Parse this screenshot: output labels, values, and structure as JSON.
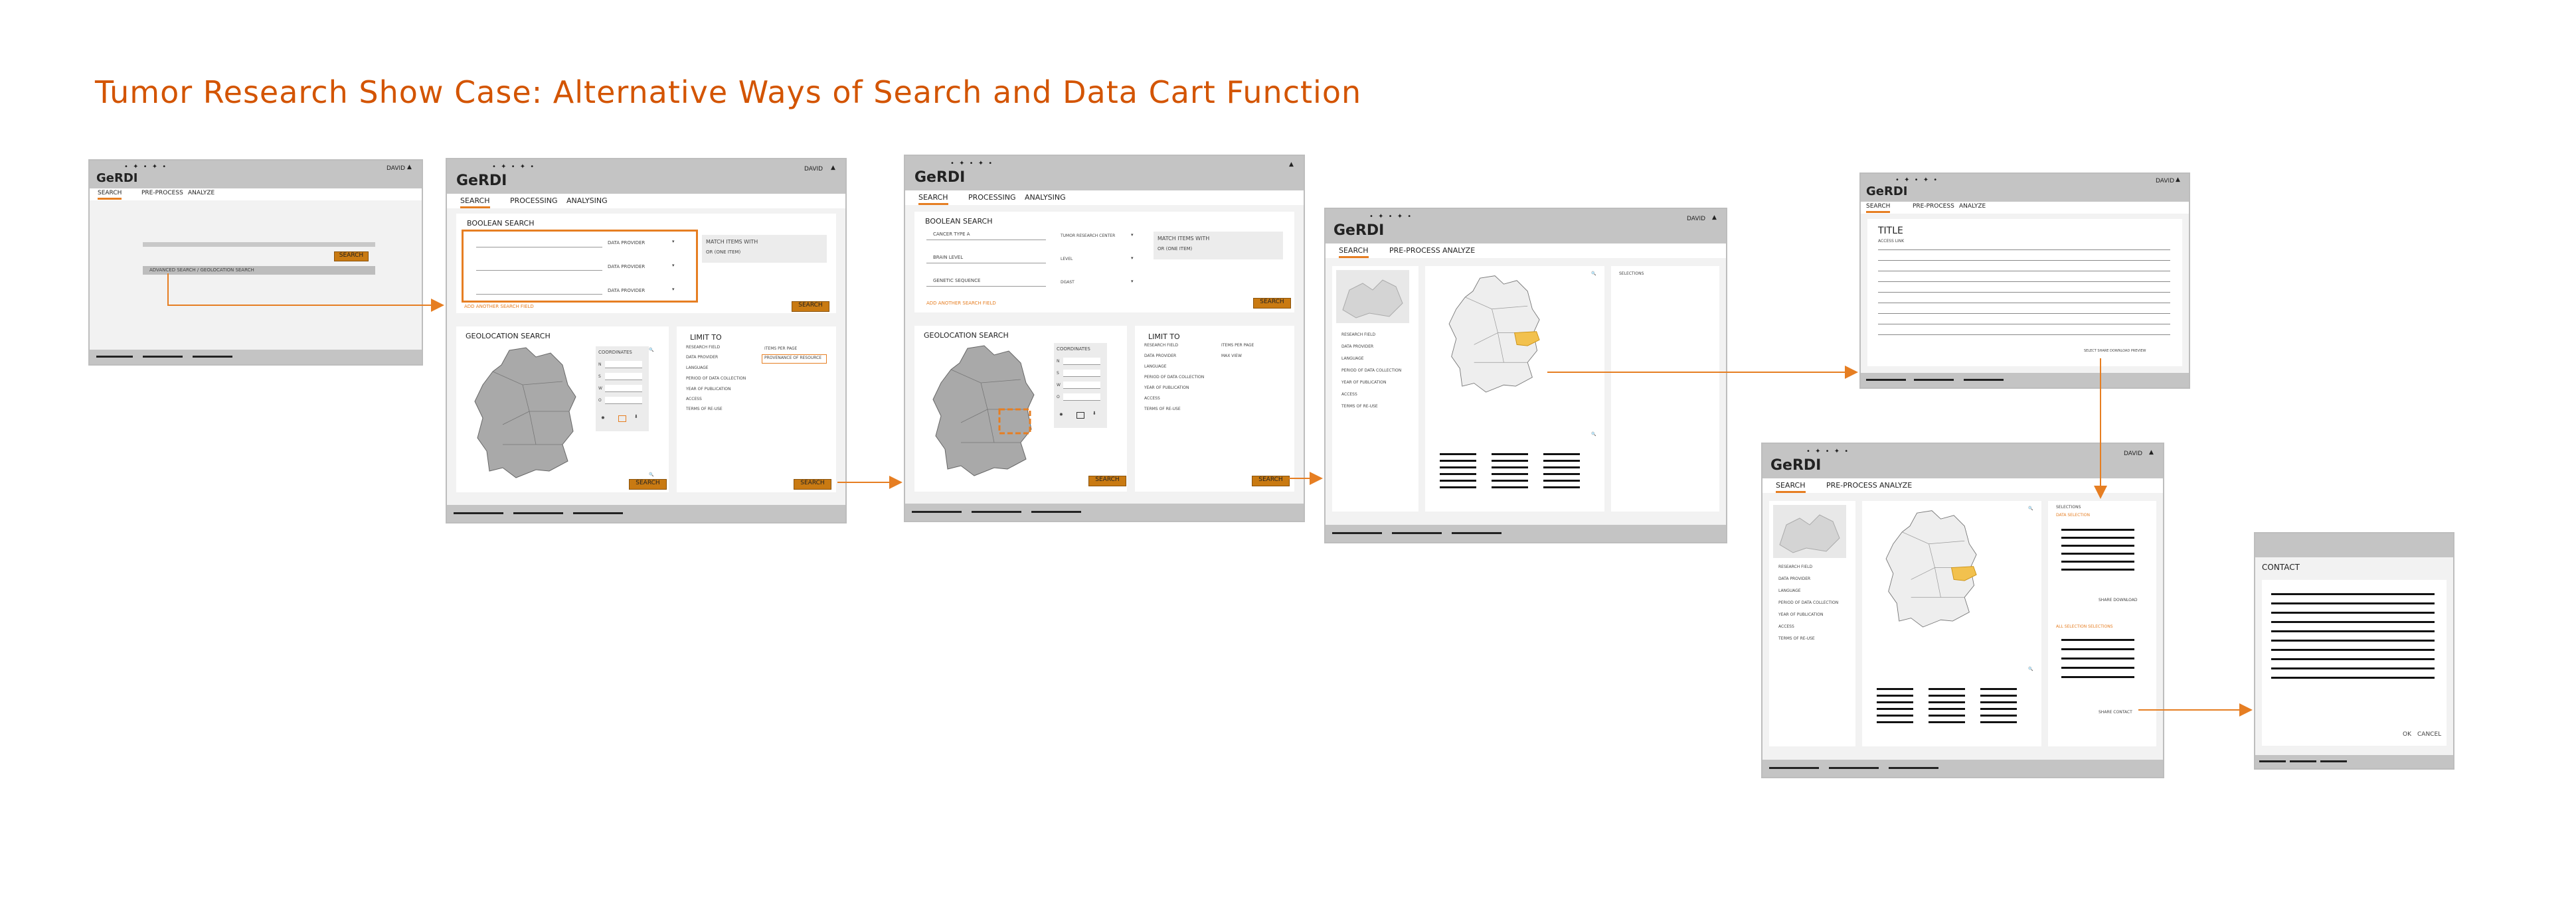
{
  "title": "Tumor Research Show Case: Alternative Ways of Search and Data Cart Function",
  "brand": {
    "logo": "GeRDI",
    "accent": "#e67e22",
    "button_color": "#c97a12",
    "header_color": "#c4c4c4"
  },
  "user_label": "DAVID",
  "tabs3": [
    "SEARCH",
    "PRE-PROCESS",
    "ANALYZE"
  ],
  "tabs_b": [
    "SEARCH",
    "PROCESSING",
    "ANALYSING"
  ],
  "s1": {
    "search_btn": "SEARCH",
    "advanced": "ADVANCED SEARCH / GEOLOCATION SEARCH"
  },
  "s2": {
    "boolean": "BOOLEAN SEARCH",
    "provider": "DATA PROVIDER",
    "match": "MATCH ITEMS WITH",
    "one_item": "OR (ONE ITEM)",
    "add_field": "ADD ANOTHER SEARCH FIELD",
    "search": "SEARCH",
    "geo": "GEOLOCATION SEARCH",
    "coords": "COORDINATES",
    "coord_n": "N",
    "coord_s": "S",
    "coord_w": "W",
    "coord_o": "O",
    "limit": "LIMIT TO",
    "limits": [
      "RESEARCH FIELD",
      "DATA PROVIDER",
      "LANGUAGE",
      "PERIOD OF DATA COLLECTION",
      "YEAR OF PUBLICATION",
      "ACCESS",
      "TERMS OF RE-USE"
    ],
    "items_page": "ITEMS PER PAGE",
    "provenance": "PROVENANCE OF RESOURCE"
  },
  "s3": {
    "boolean": "BOOLEAN SEARCH",
    "r1_label": "CANCER TYPE A",
    "r1_val": "TUMOR RESEARCH CENTER",
    "r2_label": "BRAIN LEVEL",
    "r2_val": "LEVEL",
    "r3_label": "GENETIC SEQUENCE",
    "r3_val": "DGAST",
    "match": "MATCH ITEMS WITH",
    "one_item": "OR (ONE ITEM)",
    "add_field": "ADD ANOTHER SEARCH FIELD",
    "search": "SEARCH",
    "geo": "GEOLOCATION SEARCH",
    "coords": "COORDINATES",
    "limit": "LIMIT TO",
    "items_page": "ITEMS PER PAGE",
    "max_view": "MAX VIEW"
  },
  "s4": {
    "selections": "SELECTIONS",
    "filters": [
      "RESEARCH FIELD",
      "DATA PROVIDER",
      "LANGUAGE",
      "PERIOD OF DATA COLLECTION",
      "YEAR OF PUBLICATION",
      "ACCESS",
      "TERMS OF RE-USE"
    ]
  },
  "s5": {
    "title": "TITLE",
    "access_link": "ACCESS LINK",
    "actions": "SELECT  SHARE  DOWNLOAD  PREVIEW"
  },
  "s6": {
    "selections": "SELECTIONS",
    "section1": "DATA SELECTION",
    "section2": "ALL SELECTION SELECTIONS",
    "actions1": "SHARE  DOWNLOAD",
    "actions2": "SHARE  CONTACT"
  },
  "s7": {
    "contact": "CONTACT",
    "ok": "OK",
    "cancel": "CANCEL"
  }
}
